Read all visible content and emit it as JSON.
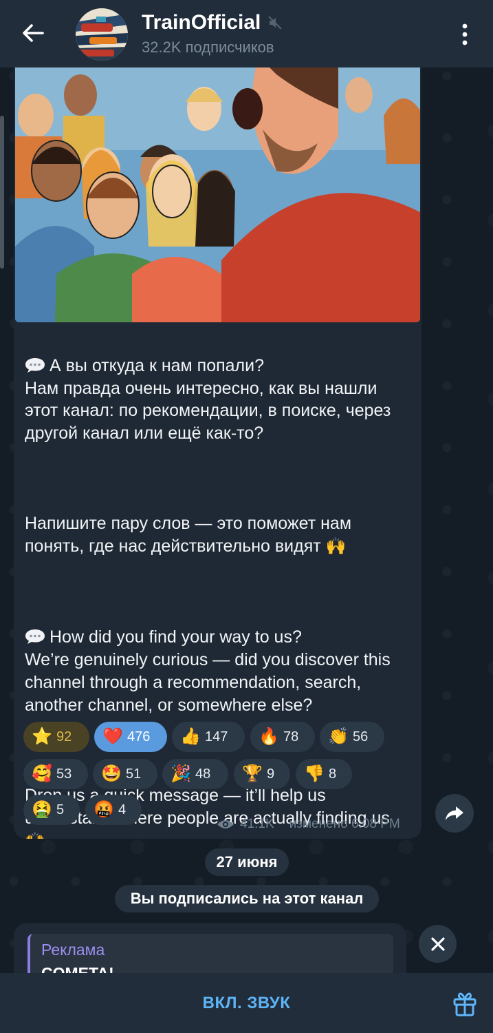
{
  "header": {
    "title": "TrainOfficial",
    "subscribers": "32.2K подписчиков",
    "muted": true
  },
  "post": {
    "paragraphs": [
      "А вы откуда к нам попали?\nНам правда очень интересно, как вы нашли этот канал: по рекомендации, в поиске, через другой канал или ещё как-то?",
      "Напишите пару слов — это поможет нам понять, где нас действительно видят",
      "How did you find your way to us?\nWe’re genuinely curious — did you discover this channel through a recommendation, search, another channel, or somewhere else?",
      "Drop us a quick message — it’ll help us understand where people are actually finding us"
    ],
    "views": "41.1K",
    "edited": "изменено 6:08 PM"
  },
  "reactions": [
    {
      "emoji": "⭐",
      "count": "92",
      "style": "gold"
    },
    {
      "emoji": "❤️",
      "count": "476",
      "style": "blue"
    },
    {
      "emoji": "👍",
      "count": "147",
      "style": "normal"
    },
    {
      "emoji": "🔥",
      "count": "78",
      "style": "normal"
    },
    {
      "emoji": "👏",
      "count": "56",
      "style": "normal"
    },
    {
      "emoji": "🥰",
      "count": "53",
      "style": "normal"
    },
    {
      "emoji": "🤩",
      "count": "51",
      "style": "normal"
    },
    {
      "emoji": "🎉",
      "count": "48",
      "style": "normal"
    },
    {
      "emoji": "🏆",
      "count": "9",
      "style": "normal"
    },
    {
      "emoji": "👎",
      "count": "8",
      "style": "normal"
    },
    {
      "emoji": "🤮",
      "count": "5",
      "style": "normal"
    },
    {
      "emoji": "🤬",
      "count": "4",
      "style": "normal"
    }
  ],
  "date_chip": "27 июня",
  "service_message": "Вы подписались на этот канал",
  "ad": {
    "label": "Реклама",
    "title": "COMETA!"
  },
  "bottom": {
    "unmute_label": "ВКЛ. ЗВУК"
  },
  "icons": {
    "back": "arrow-left-icon",
    "menu": "more-vertical-icon",
    "mute": "muted-speaker-icon",
    "share": "share-icon",
    "close": "close-icon",
    "gift": "gift-icon",
    "views": "eye-icon"
  },
  "colors": {
    "header_bg": "#212d3b",
    "bubble_bg": "#1e2935",
    "accent": "#5eb5f7",
    "ad_accent": "#9b8ff0"
  }
}
